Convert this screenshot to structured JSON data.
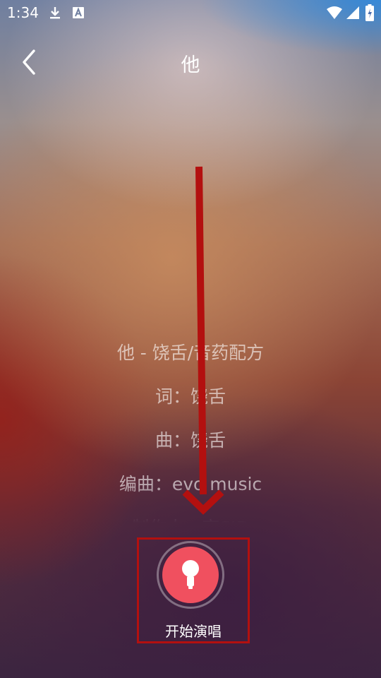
{
  "status_bar": {
    "time": "1:34",
    "icons": [
      "download-icon",
      "text-a-icon",
      "wifi-icon",
      "signal-icon",
      "battery-icon"
    ]
  },
  "header": {
    "back_icon": "chevron-left-icon",
    "title": "他"
  },
  "lyrics": {
    "lines": [
      "他 - 饶舌/音药配方",
      "词：饶舌",
      "曲：饶舌",
      "编曲：evo music",
      "制作人：高SID"
    ]
  },
  "sing_button": {
    "icon": "microphone-icon",
    "label": "开始演唱"
  },
  "annotation": {
    "color": "#b3100f"
  }
}
